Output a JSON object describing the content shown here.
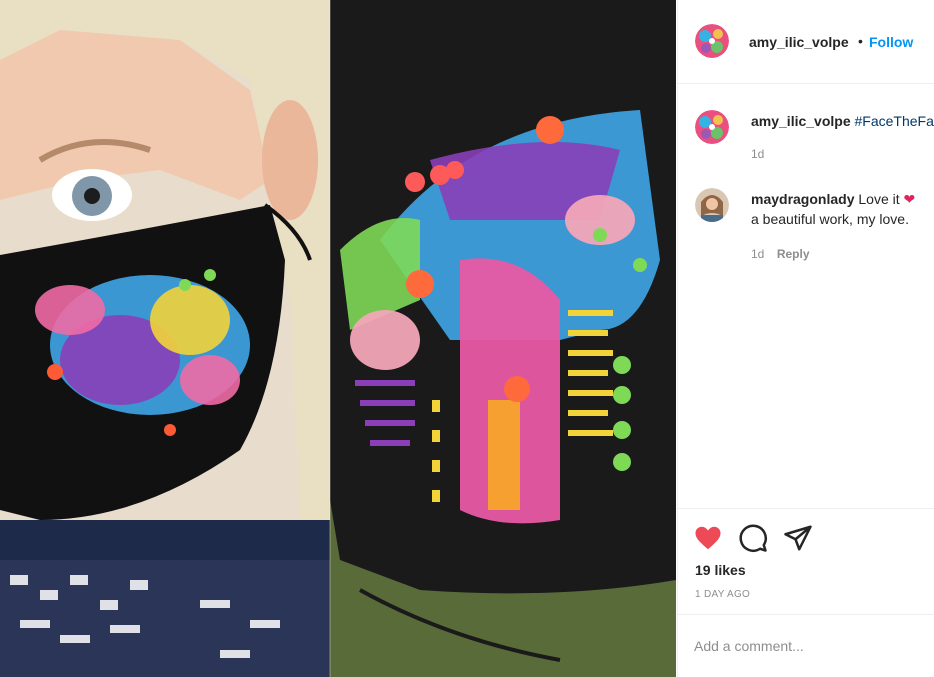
{
  "post": {
    "author": "amy_ilic_volpe",
    "follow_separator": "•",
    "follow_label": "Follow",
    "avatar_colors": [
      "#e94f7f",
      "#34b3e4",
      "#f2c14e",
      "#6ac36a",
      "#9b59b6"
    ]
  },
  "image": {
    "description_icon": "photo-collage"
  },
  "comments": [
    {
      "username": "amy_ilic_volpe",
      "text": "#FaceTheFa",
      "time": "1d"
    },
    {
      "username": "maydragonlady",
      "text_line1": "Love it",
      "emoji": "❤",
      "text_line2": "a beautiful work, my love.",
      "time": "1d",
      "reply_label": "Reply"
    }
  ],
  "actions": {
    "like_icon": "heart-filled",
    "comment_icon": "speech-bubble",
    "share_icon": "paper-plane",
    "liked_color": "#ed4956"
  },
  "likes_label": "19 likes",
  "time_ago": "1 DAY AGO",
  "add_comment_placeholder": "Add a comment..."
}
